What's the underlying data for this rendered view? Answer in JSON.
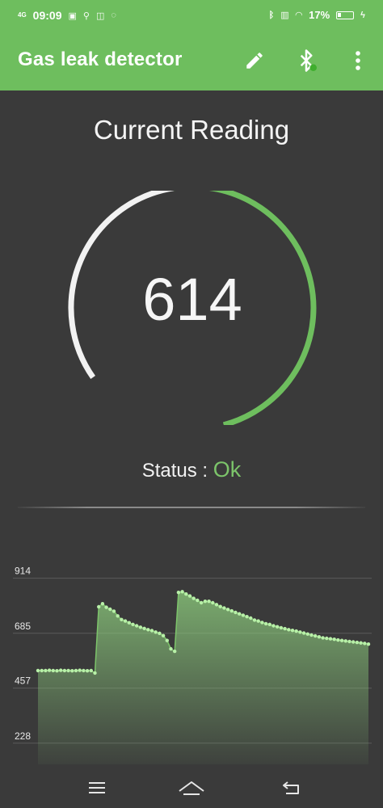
{
  "status_bar": {
    "network": "4G",
    "time": "09:09",
    "battery_percent": "17%"
  },
  "app_bar": {
    "title": "Gas leak detector",
    "icons": [
      "edit-icon",
      "bluetooth-icon",
      "more-vert-icon"
    ]
  },
  "main": {
    "title": "Current Reading",
    "reading": "614",
    "gauge_fill_fraction": 0.6,
    "status_label": "Status : ",
    "status_value": "Ok"
  },
  "colors": {
    "accent": "#6ebe5e",
    "status_ok": "#7cc46a",
    "background": "#3a3a3a",
    "gauge_track": "#f2f2f2"
  },
  "chart_data": {
    "type": "area",
    "title": "",
    "xlabel": "",
    "ylabel": "",
    "yticks": [
      228,
      457,
      685,
      914
    ],
    "ylim": [
      140,
      1000
    ],
    "grid": true,
    "legend": "none",
    "series": [
      {
        "values": [
          530,
          530,
          530,
          531,
          530,
          529,
          531,
          530,
          530,
          529,
          530,
          531,
          530,
          529,
          530,
          520,
          795,
          808,
          793,
          785,
          777,
          757,
          742,
          736,
          729,
          722,
          716,
          710,
          705,
          700,
          696,
          690,
          685,
          675,
          655,
          620,
          610,
          855,
          858,
          848,
          840,
          830,
          822,
          812,
          818,
          818,
          812,
          804,
          796,
          790,
          784,
          778,
          772,
          766,
          760,
          754,
          748,
          740,
          736,
          730,
          725,
          722,
          716,
          712,
          708,
          704,
          700,
          697,
          694,
          690,
          686,
          682,
          678,
          674,
          670,
          666,
          664,
          662,
          660,
          657,
          655,
          653,
          651,
          649,
          647,
          645,
          643,
          640
        ]
      }
    ]
  },
  "nav_bar": {
    "icons": [
      "menu-icon",
      "home-icon",
      "back-icon"
    ]
  }
}
